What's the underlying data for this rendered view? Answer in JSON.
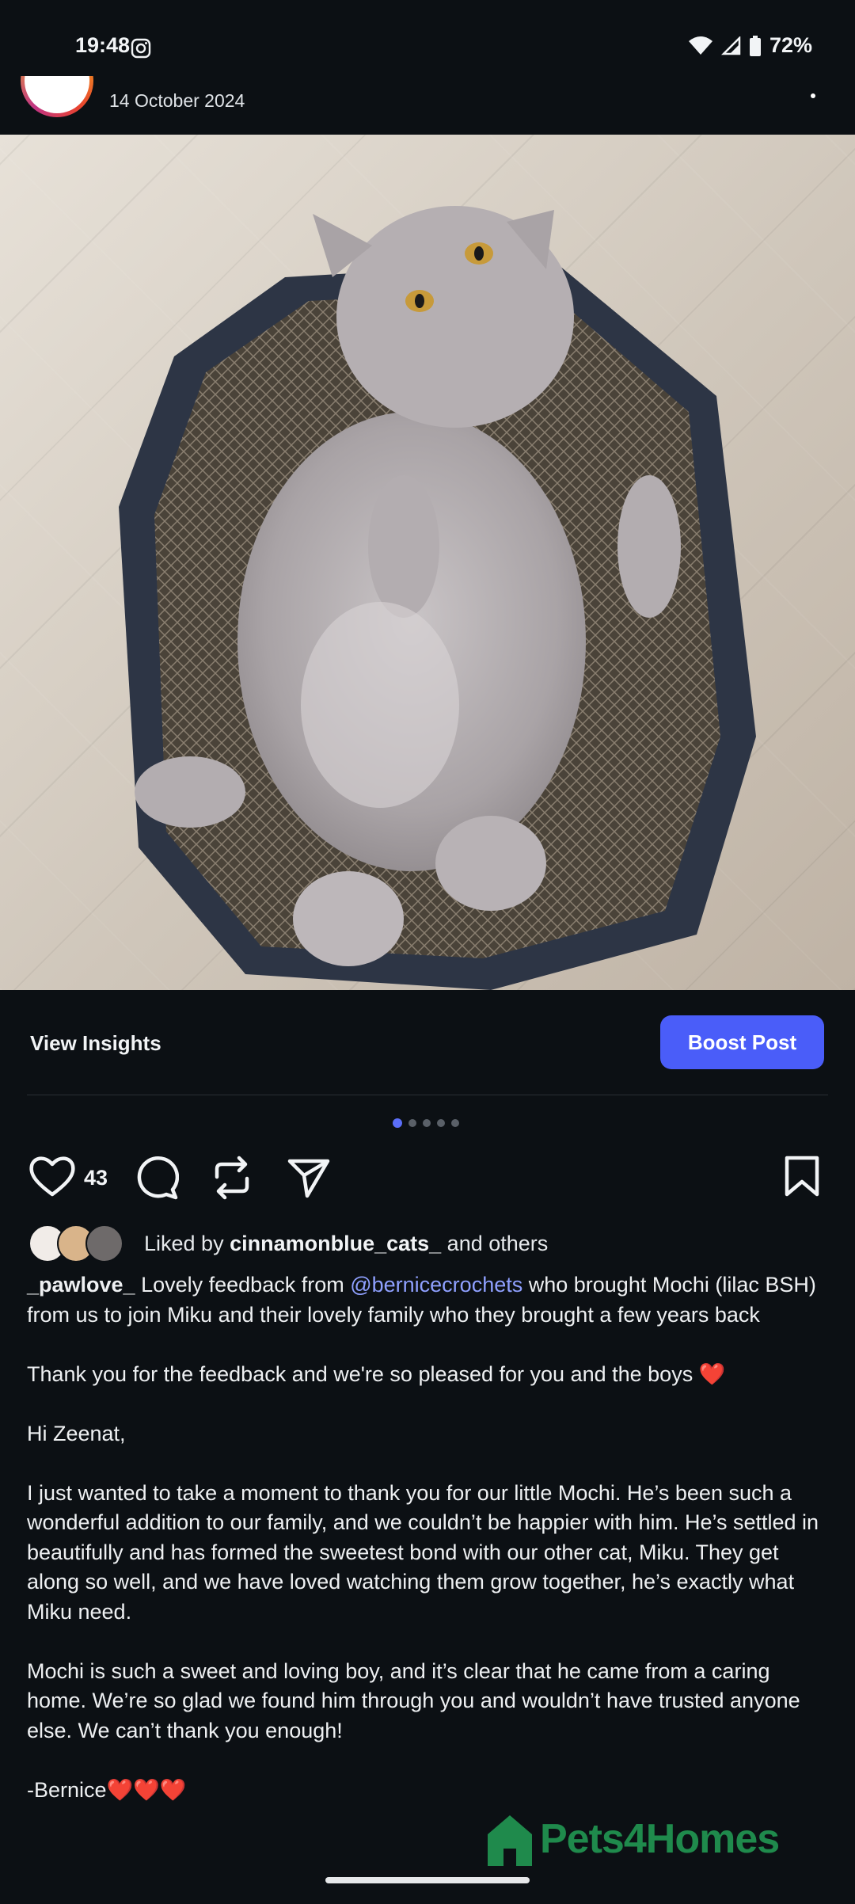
{
  "status_bar": {
    "time": "19:48",
    "battery": "72%"
  },
  "post": {
    "date": "14 October 2024"
  },
  "insights": {
    "view_label": "View Insights",
    "boost_label": "Boost Post"
  },
  "carousel": {
    "count": 5,
    "active_index": 0
  },
  "actions": {
    "like_count": "43"
  },
  "liked_by": {
    "prefix": "Liked by ",
    "user": "cinnamonblue_cats_",
    "suffix": " and others"
  },
  "caption": {
    "username": "_pawlove_",
    "lead": " Lovely feedback from ",
    "mention": "@bernicecrochets",
    "lead_rest": " who brought Mochi (lilac BSH) from us to join Miku and their lovely family who they brought a few years back",
    "thanks": "Thank you for the feedback and we're so pleased for you and the boys ",
    "greeting": "Hi Zeenat,",
    "para1": "I just wanted to take a moment to thank you for our little Mochi. He’s been such a wonderful addition to our family, and we couldn’t be happier with him. He’s settled in beautifully and has formed the sweetest bond with our other cat, Miku. They get along so well, and we have loved watching them grow together, he’s exactly what Miku need.",
    "para2": "Mochi is such a sweet and loving boy, and it’s clear that he came from a caring home. We’re so glad we found him through you and wouldn’t have trusted anyone else. We can’t thank you enough!",
    "signoff": "-Bernice",
    "hearts": "❤️❤️❤️",
    "thanks_heart": "❤️"
  },
  "watermark": {
    "text": "Pets4Homes"
  },
  "colors": {
    "accent": "#4a5df9",
    "mention": "#8fa0ff",
    "background": "#0c1014"
  }
}
